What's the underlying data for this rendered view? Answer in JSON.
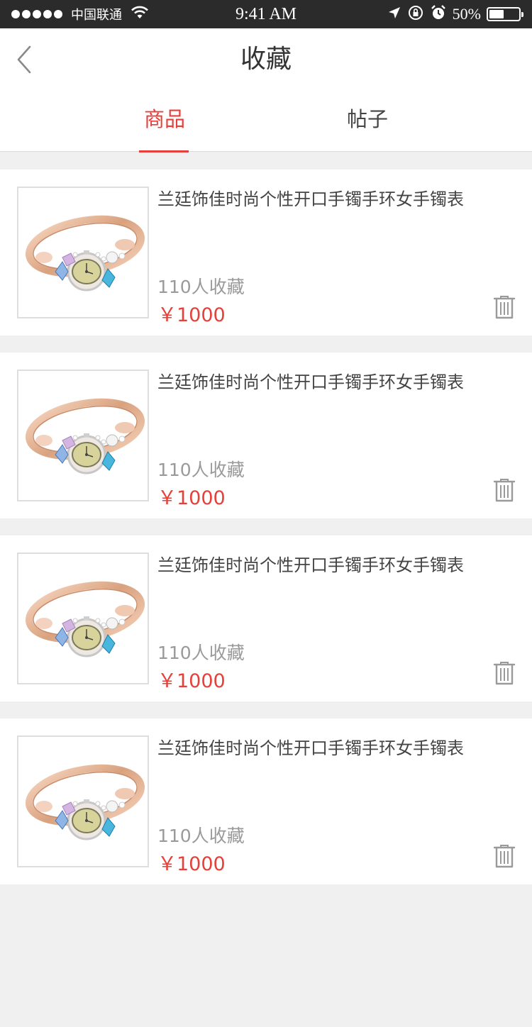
{
  "status_bar": {
    "carrier": "中国联通",
    "time": "9:41 AM",
    "battery_percent": "50%",
    "battery_level": 0.5
  },
  "nav": {
    "title": "收藏"
  },
  "tabs": [
    {
      "label": "商品",
      "active": true
    },
    {
      "label": "帖子",
      "active": false
    }
  ],
  "colors": {
    "accent": "#e7403a",
    "background": "#f0f0f0",
    "text": "#444444",
    "muted": "#9a9a9a"
  },
  "items": [
    {
      "title": "兰廷饰佳时尚个性开口手镯手环女手镯表",
      "favorites": "110人收藏",
      "price": "￥1000"
    },
    {
      "title": "兰廷饰佳时尚个性开口手镯手环女手镯表",
      "favorites": "110人收藏",
      "price": "￥1000"
    },
    {
      "title": "兰廷饰佳时尚个性开口手镯手环女手镯表",
      "favorites": "110人收藏",
      "price": "￥1000"
    },
    {
      "title": "兰廷饰佳时尚个性开口手镯手环女手镯表",
      "favorites": "110人收藏",
      "price": "￥1000"
    }
  ]
}
